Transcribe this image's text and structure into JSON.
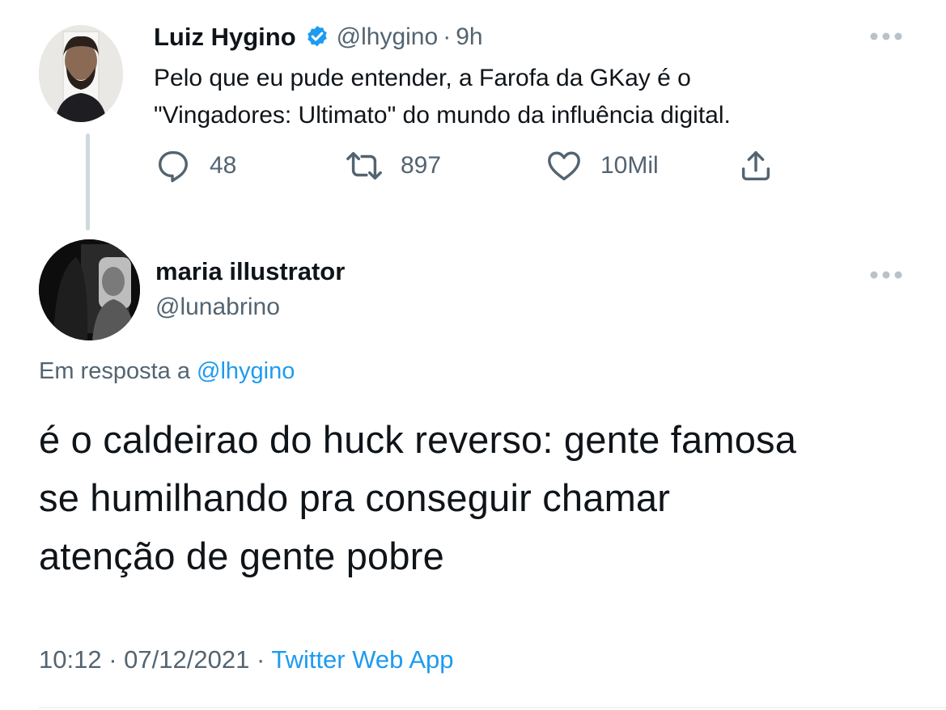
{
  "parent": {
    "author_name": "Luiz Hygino",
    "handle": "@lhygino",
    "separator": "·",
    "time": "9h",
    "text_line1": "Pelo que eu pude entender, a Farofa da GKay é o",
    "text_line2": "\"Vingadores: Ultimato\" do mundo da influência digital.",
    "replies": "48",
    "retweets": "897",
    "likes": "10Mil",
    "icons": [
      "reply-icon",
      "retweet-icon",
      "like-icon",
      "share-icon",
      "more-icon",
      "verified-icon"
    ],
    "colors": {
      "verified": "#1d9bf0",
      "muted": "#536471"
    }
  },
  "reply": {
    "author_name": "maria illustrator",
    "handle": "@lunabrino",
    "reply_prefix": "Em resposta a",
    "reply_to": "@lhygino",
    "text_line1": "é o caldeirao do huck reverso: gente famosa",
    "text_line2": "se humilhando pra conseguir chamar",
    "text_line3": "atenção de gente pobre",
    "time": "10:12",
    "separator": "·",
    "date": "07/12/2021",
    "separator2": "·",
    "source": "Twitter Web App",
    "colors": {
      "link": "#1d9bf0"
    }
  }
}
